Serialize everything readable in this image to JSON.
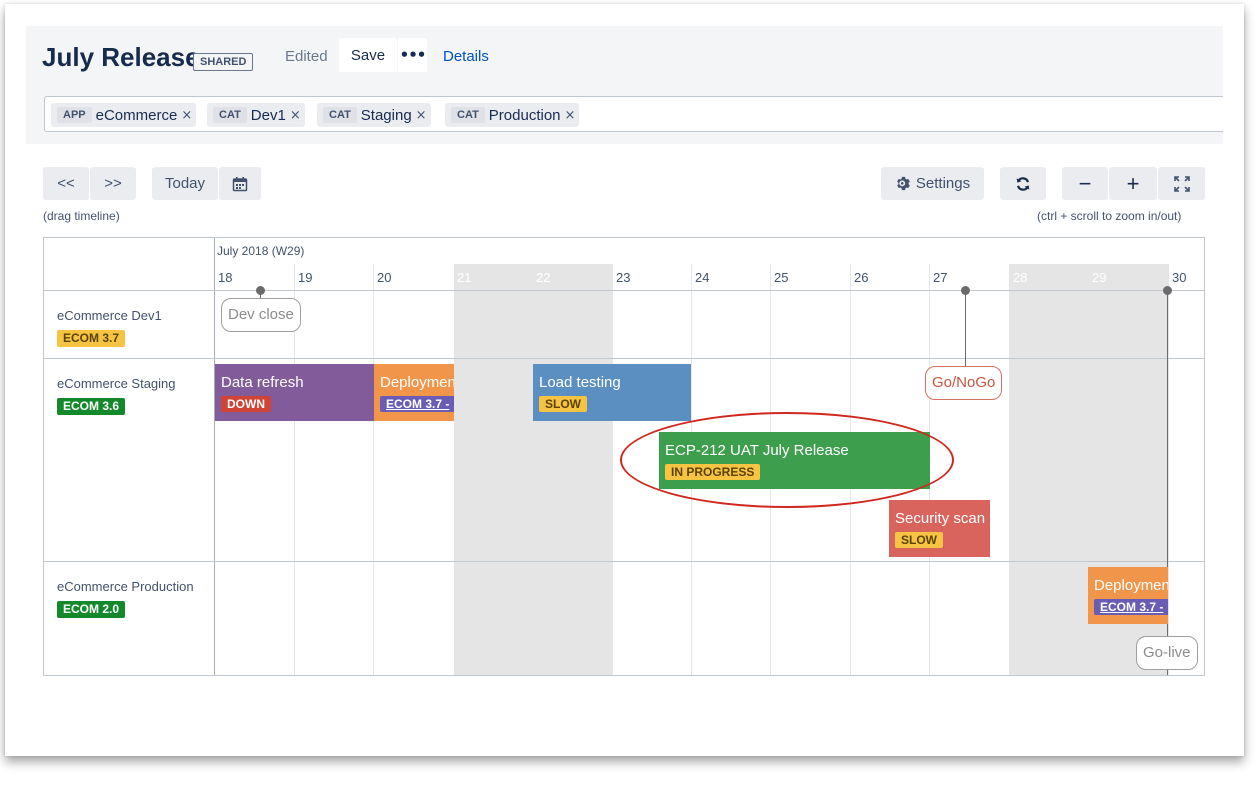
{
  "header": {
    "title": "July Release",
    "shared_badge": "SHARED",
    "edited_label": "Edited",
    "save_label": "Save",
    "more_label": "•••",
    "details_label": "Details"
  },
  "filters": [
    {
      "type": "APP",
      "value": "eCommerce",
      "remove": "×"
    },
    {
      "type": "CAT",
      "value": "Dev1",
      "remove": "×"
    },
    {
      "type": "CAT",
      "value": "Staging",
      "remove": "×"
    },
    {
      "type": "CAT",
      "value": "Production",
      "remove": "×"
    }
  ],
  "toolbar": {
    "prev_label": "<<",
    "next_label": ">>",
    "today_label": "Today",
    "calendar_icon": "calendar-icon",
    "drag_hint": "(drag timeline)",
    "settings_label": "Settings",
    "settings_icon": "gear-icon",
    "refresh_icon": "refresh-icon",
    "zoom_out_label": "−",
    "zoom_in_label": "+",
    "fullscreen_icon": "fullscreen-icon",
    "zoom_hint": "(ctrl + scroll to zoom in/out)"
  },
  "timeline": {
    "month_label": "July 2018 (W29)",
    "days": [
      "18",
      "19",
      "20",
      "21",
      "22",
      "23",
      "24",
      "25",
      "26",
      "27",
      "28",
      "29",
      "30"
    ],
    "weekend_days": [
      "21",
      "22",
      "28",
      "29"
    ]
  },
  "rows": [
    {
      "label": "eCommerce Dev1",
      "badge": "ECOM 3.7",
      "badge_bg": "#f6c342",
      "badge_fg": "#594300"
    },
    {
      "label": "eCommerce Staging",
      "badge": "ECOM 3.6",
      "badge_bg": "#14892c",
      "badge_fg": "#ffffff"
    },
    {
      "label": "eCommerce Production",
      "badge": "ECOM 2.0",
      "badge_bg": "#14892c",
      "badge_fg": "#ffffff"
    }
  ],
  "milestones": {
    "dev_close": "Dev close",
    "go_nogo": "Go/NoGo",
    "go_live": "Go-live"
  },
  "bars": {
    "data_refresh": {
      "title": "Data refresh",
      "tag": "DOWN",
      "color": "#815b9a"
    },
    "deployment_staging": {
      "title": "Deployment",
      "link": "ECOM 3.7",
      "link_suffix": " -",
      "color": "#f0954a"
    },
    "load_testing": {
      "title": "Load testing",
      "tag": "SLOW",
      "color": "#5b8fc2"
    },
    "uat_release": {
      "title": "ECP-212 UAT July Release",
      "tag": "IN PROGRESS",
      "color": "#3d9e4e"
    },
    "security_scan": {
      "title": "Security scan",
      "tag": "SLOW",
      "color": "#d9635d"
    },
    "deployment_prod": {
      "title": "Deployment",
      "link": "ECOM 3.7",
      "link_suffix": " -",
      "color": "#f0954a"
    }
  },
  "tags": {
    "down_bg": "#d04437",
    "slow_bg": "#f6c342",
    "in_progress_bg": "#f6c342"
  }
}
